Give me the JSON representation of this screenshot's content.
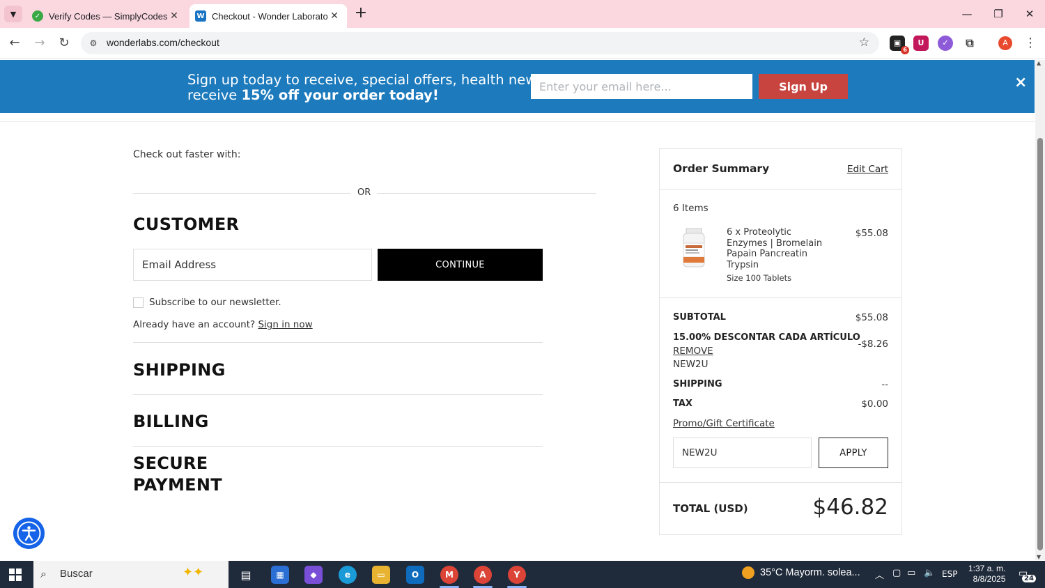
{
  "browser": {
    "tabs": [
      {
        "title": "Verify Codes — SimplyCodes",
        "active": false
      },
      {
        "title": "Checkout - Wonder Laboratories",
        "active": true
      }
    ],
    "url": "wonderlabs.com/checkout",
    "extensions": [
      {
        "name": "extension-badge-count",
        "badge": "6"
      }
    ],
    "profile_initial": "A"
  },
  "banner": {
    "text_line1": "Sign up today to receive, special offers, health news, and",
    "text_line2_prefix": "receive ",
    "text_line2_bold": "15% off your order today!",
    "email_placeholder": "Enter your email here...",
    "signup_label": "Sign Up",
    "close_label": "×"
  },
  "checkout": {
    "faster_label": "Check out faster with:",
    "or_label": "OR",
    "customer_heading": "CUSTOMER",
    "email_placeholder": "Email Address",
    "continue_label": "CONTINUE",
    "newsletter_label": "Subscribe to our newsletter.",
    "account_prompt": "Already have an account? ",
    "sign_in_label": "Sign in now",
    "shipping_heading": "SHIPPING",
    "billing_heading": "BILLING",
    "payment_heading_line1": "SECURE",
    "payment_heading_line2": "PAYMENT"
  },
  "summary": {
    "title": "Order Summary",
    "edit_cart_label": "Edit Cart",
    "items_count": "6 Items",
    "product": {
      "name": "6 x Proteolytic Enzymes | Bromelain Papain Pancreatin Trypsin",
      "size": "Size 100 Tablets",
      "price": "$55.08"
    },
    "subtotal_label": "SUBTOTAL",
    "subtotal_value": "$55.08",
    "discount_label": "15.00% DESCONTAR CADA ARTÍCULO",
    "discount_value": "-$8.26",
    "remove_label": "REMOVE",
    "coupon_code": "NEW2U",
    "shipping_label": "SHIPPING",
    "shipping_value": "--",
    "tax_label": "TAX",
    "tax_value": "$0.00",
    "promo_link_label": "Promo/Gift Certificate",
    "coupon_input_value": "NEW2U",
    "apply_label": "APPLY",
    "total_label": "TOTAL (USD)",
    "total_value": "$46.82"
  },
  "taskbar": {
    "search_placeholder": "Buscar",
    "weather": "35°C  Mayorm. solea...",
    "language": "ESP",
    "time": "1:37 a. m.",
    "date": "8/8/2025",
    "notification_count": "24"
  },
  "colors": {
    "banner_bg": "#1d7bbd",
    "signup_btn": "#c8443f",
    "titlebar_bg": "#fbd7e0",
    "taskbar_bg": "#1f2a3a",
    "a11y_btn": "#1463e8"
  }
}
